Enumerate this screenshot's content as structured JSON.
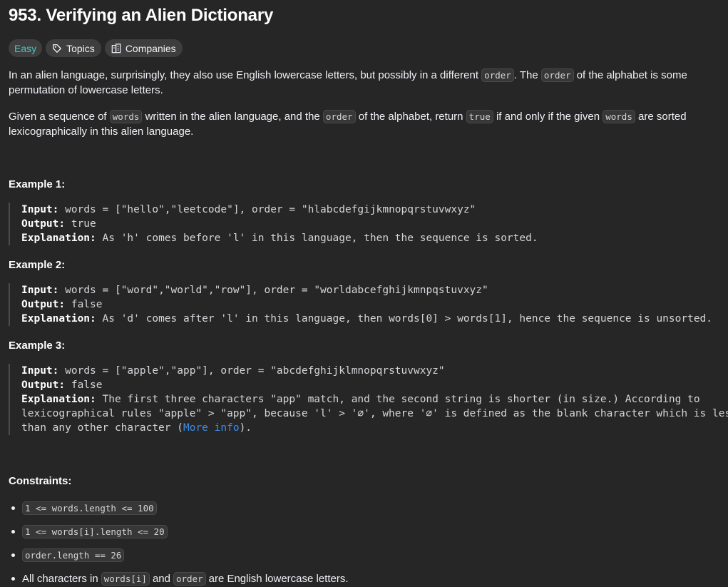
{
  "problem": {
    "title": "953. Verifying an Alien Dictionary",
    "difficulty": "Easy",
    "topics_label": "Topics",
    "companies_label": "Companies"
  },
  "description": {
    "p1": [
      "In an alien language, surprisingly, they also use English lowercase letters, but possibly in a different ",
      "order",
      ". The ",
      "order",
      " of the alphabet is some permutation of lowercase letters."
    ],
    "p2": [
      "Given a sequence of ",
      "words",
      " written in the alien language, and the ",
      "order",
      " of the alphabet, return ",
      "true",
      " if and only if the given ",
      "words",
      " are sorted lexicographically in this alien language."
    ]
  },
  "examples": [
    {
      "heading": "Example 1:",
      "input_label": "Input:",
      "input": "words = [\"hello\",\"leetcode\"], order = \"hlabcdefgijkmnopqrstuvwxyz\"",
      "output_label": "Output:",
      "output": "true",
      "explanation_label": "Explanation:",
      "explanation": "As 'h' comes before 'l' in this language, then the sequence is sorted."
    },
    {
      "heading": "Example 2:",
      "input_label": "Input:",
      "input": "words = [\"word\",\"world\",\"row\"], order = \"worldabcefghijkmnpqstuvxyz\"",
      "output_label": "Output:",
      "output": "false",
      "explanation_label": "Explanation:",
      "explanation": "As 'd' comes after 'l' in this language, then words[0] > words[1], hence the sequence is unsorted."
    },
    {
      "heading": "Example 3:",
      "input_label": "Input:",
      "input": "words = [\"apple\",\"app\"], order = \"abcdefghijklmnopqrstuvwxyz\"",
      "output_label": "Output:",
      "output": "false",
      "explanation_label": "Explanation:",
      "explanation_line1": "The first three characters \"app\" match, and the second string is shorter (in size.) According to",
      "explanation_line2": "lexicographical rules \"apple\" > \"app\", because 'l' > '∅', where '∅' is defined as the blank character which is less",
      "explanation_line3_pre": "than any other character (",
      "more_info_link": "More info",
      "explanation_line3_post": ")."
    }
  ],
  "constraints": {
    "heading": "Constraints:",
    "items": [
      {
        "code": "1 <= words.length <= 100"
      },
      {
        "code": "1 <= words[i].length <= 20"
      },
      {
        "code": "order.length == 26"
      },
      {
        "parts": [
          "All characters in ",
          "words[i]",
          " and ",
          "order",
          " are English lowercase letters."
        ]
      }
    ]
  },
  "icons": {
    "topics": "tag-icon",
    "companies": "building-icon"
  },
  "colors": {
    "background": "#262626",
    "easy": "#46c6c2",
    "link": "#3b8ce9"
  }
}
